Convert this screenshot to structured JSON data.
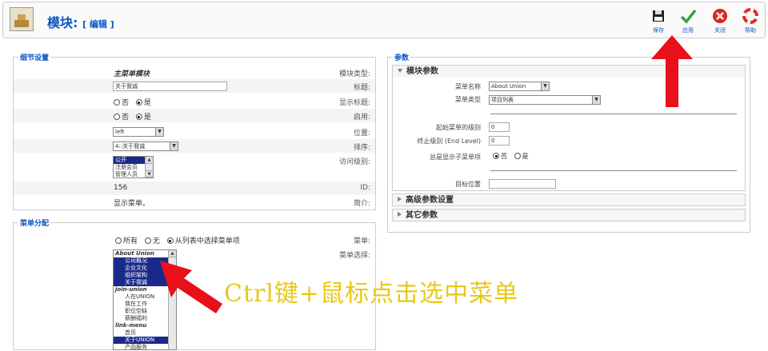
{
  "header": {
    "title": "模块:",
    "subtitle": "[ 编辑 ]",
    "buttons": [
      {
        "label": "保存",
        "icon": "save-icon"
      },
      {
        "label": "应用",
        "icon": "apply-check-icon"
      },
      {
        "label": "关闭",
        "icon": "close-icon"
      },
      {
        "label": "帮助",
        "icon": "help-icon"
      }
    ]
  },
  "details": {
    "legend": "细节设置",
    "module_type_label": "模块类型:",
    "module_type_value": "主菜单模块",
    "title_label": "标题:",
    "title_value": "关于我诚",
    "show_title_label": "显示标题:",
    "enabled_label": "启用:",
    "no": "否",
    "yes": "是",
    "position_label": "位置:",
    "position_value": "left",
    "order_label": "排序:",
    "order_value": "4::关于我诚",
    "access_label": "访问级别:",
    "access_options": [
      "公开",
      "注册会员",
      "管理人员"
    ],
    "id_label": "ID:",
    "id_value": "156",
    "desc_label": "简介:",
    "desc_value": "显示菜单。"
  },
  "menu_assign": {
    "legend": "菜单分配",
    "menus_label": "菜单:",
    "opt_all": "所有",
    "opt_none": "无",
    "opt_select": "从列表中选择菜单项",
    "select_label": "菜单选择:",
    "items": [
      {
        "text": "About Union",
        "group": true,
        "sel": false
      },
      {
        "text": "公司概况",
        "group": false,
        "sel": true
      },
      {
        "text": "企业文化",
        "group": false,
        "sel": true
      },
      {
        "text": "组织架构",
        "group": false,
        "sel": true
      },
      {
        "text": "关于我诚",
        "group": false,
        "sel": true
      },
      {
        "text": "join-union",
        "group": true,
        "sel": false
      },
      {
        "text": "人在UNION",
        "group": false,
        "sel": false
      },
      {
        "text": "我在工作",
        "group": false,
        "sel": false
      },
      {
        "text": "职位空缺",
        "group": false,
        "sel": false
      },
      {
        "text": "薪酬福利",
        "group": false,
        "sel": false
      },
      {
        "text": "link-menu",
        "group": true,
        "sel": false
      },
      {
        "text": "首页",
        "group": false,
        "sel": false
      },
      {
        "text": "关于UNION",
        "group": false,
        "sel": true
      },
      {
        "text": "产品服务",
        "group": false,
        "sel": false
      }
    ]
  },
  "params": {
    "legend": "参数",
    "module_params_title": "模块参数",
    "menu_name_label": "菜单名称",
    "menu_name_value": "About Union",
    "menu_style_label": "菜单类型",
    "menu_style_value": "项目列表",
    "start_level_label": "起始菜单的级别",
    "start_level_value": "0",
    "end_level_label": "终止级别 (End Level)",
    "end_level_value": "0",
    "show_sub_label": "总是显示子菜单项",
    "target_label": "目标位置",
    "advanced_title": "高级参数设置",
    "other_title": "其它参数"
  },
  "annotation": {
    "text": "Ctrl键+鼠标点击选中菜单",
    "color": "#e8c81a",
    "arrow_color": "#e8101a"
  }
}
